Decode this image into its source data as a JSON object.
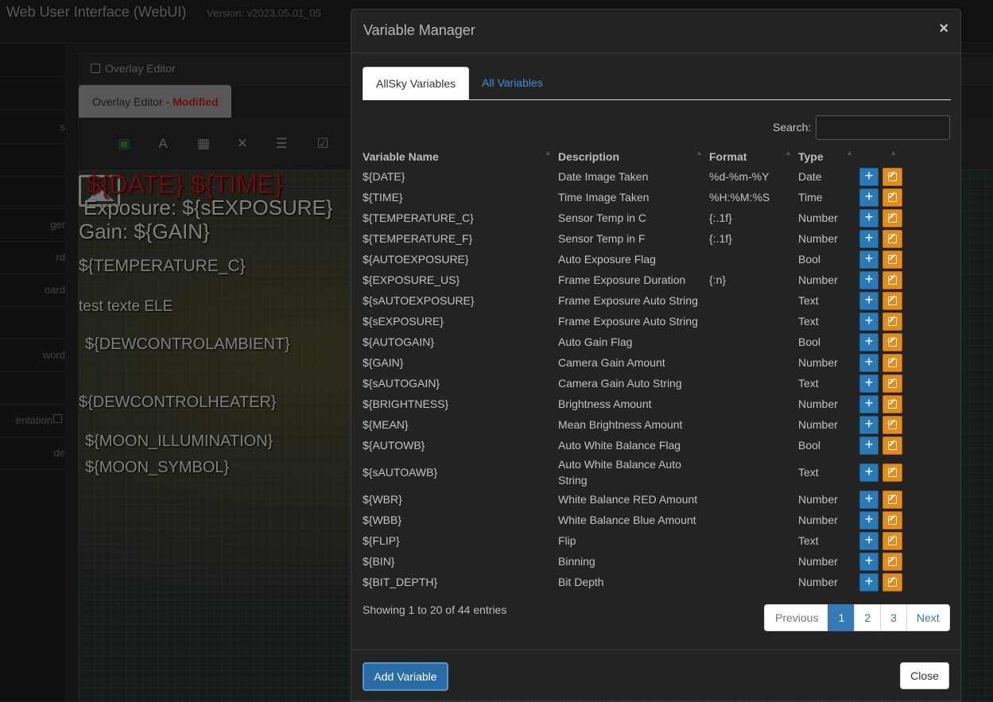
{
  "app": {
    "title": "Web User Interface (WebUI)",
    "version": "Version: v2023.05.01_05"
  },
  "sidebar": {
    "items": [
      {
        "label": ""
      },
      {
        "label": "s"
      },
      {
        "label": ""
      },
      {
        "label": ""
      },
      {
        "label": "ger"
      },
      {
        "label": "rd"
      },
      {
        "label": "oard"
      },
      {
        "label": ""
      },
      {
        "label": "word"
      },
      {
        "label": ""
      },
      {
        "label": "entation"
      },
      {
        "label": "de"
      }
    ]
  },
  "editor": {
    "panel_title": "Overlay Editor",
    "tab_label": "Overlay Editor",
    "tab_modified": " - Modified",
    "overlay_texts": [
      "${DATE} ${TIME}",
      "Exposure: ${sEXPOSURE}",
      "Gain: ${GAIN}",
      "${TEMPERATURE_C}",
      "test texte ELE",
      "${DEWCONTROLAMBIENT}",
      "${DEWCONTROLHEATER}",
      "${MOON_ILLUMINATION}",
      "${MOON_SYMBOL}"
    ]
  },
  "modal": {
    "title": "Variable Manager",
    "close_glyph": "×",
    "tabs": [
      {
        "label": "AllSky Variables"
      },
      {
        "label": "All Variables"
      }
    ],
    "search_label": "Search:",
    "search_value": "",
    "columns": {
      "name": "Variable Name",
      "description": "Description",
      "format": "Format",
      "type": "Type"
    },
    "rows": [
      {
        "name": "${DATE}",
        "desc": "Date Image Taken",
        "format": "%d-%m-%Y",
        "type": "Date"
      },
      {
        "name": "${TIME}",
        "desc": "Time Image Taken",
        "format": "%H:%M:%S",
        "type": "Time"
      },
      {
        "name": "${TEMPERATURE_C}",
        "desc": "Sensor Temp in C",
        "format": "{:.1f}",
        "type": "Number"
      },
      {
        "name": "${TEMPERATURE_F}",
        "desc": "Sensor Temp in F",
        "format": "{:.1f}",
        "type": "Number"
      },
      {
        "name": "${AUTOEXPOSURE}",
        "desc": "Auto Exposure Flag",
        "format": "",
        "type": "Bool"
      },
      {
        "name": "${EXPOSURE_US}",
        "desc": "Frame Exposure Duration",
        "format": "{:n}",
        "type": "Number"
      },
      {
        "name": "${sAUTOEXPOSURE}",
        "desc": "Frame Exposure Auto String",
        "format": "",
        "type": "Text"
      },
      {
        "name": "${sEXPOSURE}",
        "desc": "Frame Exposure Auto String",
        "format": "",
        "type": "Text"
      },
      {
        "name": "${AUTOGAIN}",
        "desc": "Auto Gain Flag",
        "format": "",
        "type": "Bool"
      },
      {
        "name": "${GAIN}",
        "desc": "Camera Gain Amount",
        "format": "",
        "type": "Number"
      },
      {
        "name": "${sAUTOGAIN}",
        "desc": "Camera Gain Auto String",
        "format": "",
        "type": "Text"
      },
      {
        "name": "${BRIGHTNESS}",
        "desc": "Brightness Amount",
        "format": "",
        "type": "Number"
      },
      {
        "name": "${MEAN}",
        "desc": "Mean Brightness Amount",
        "format": "",
        "type": "Number"
      },
      {
        "name": "${AUTOWB}",
        "desc": "Auto White Balance Flag",
        "format": "",
        "type": "Bool"
      },
      {
        "name": "${sAUTOAWB}",
        "desc": "Auto White Balance Auto String",
        "format": "",
        "type": "Text"
      },
      {
        "name": "${WBR}",
        "desc": "White Balance RED Amount",
        "format": "",
        "type": "Number"
      },
      {
        "name": "${WBB}",
        "desc": "White Balance Blue Amount",
        "format": "",
        "type": "Number"
      },
      {
        "name": "${FLIP}",
        "desc": "Flip",
        "format": "",
        "type": "Text"
      },
      {
        "name": "${BIN}",
        "desc": "Binning",
        "format": "",
        "type": "Number"
      },
      {
        "name": "${BIT_DEPTH}",
        "desc": "Bit Depth",
        "format": "",
        "type": "Number"
      }
    ],
    "row_actions": {
      "add_glyph": "+",
      "add_icon": "plus-icon",
      "edit_icon": "edit-icon"
    },
    "info": "Showing 1 to 20 of 44 entries",
    "pagination": {
      "prev": "Previous",
      "pages": [
        "1",
        "2",
        "3"
      ],
      "current": "1",
      "next": "Next"
    },
    "footer": {
      "add_label": "Add Variable",
      "close_label": "Close"
    }
  },
  "colors": {
    "primary": "#337ab7",
    "edit": "#e48c1a",
    "modified": "#b01919",
    "save_icon": "#2f7f33"
  }
}
